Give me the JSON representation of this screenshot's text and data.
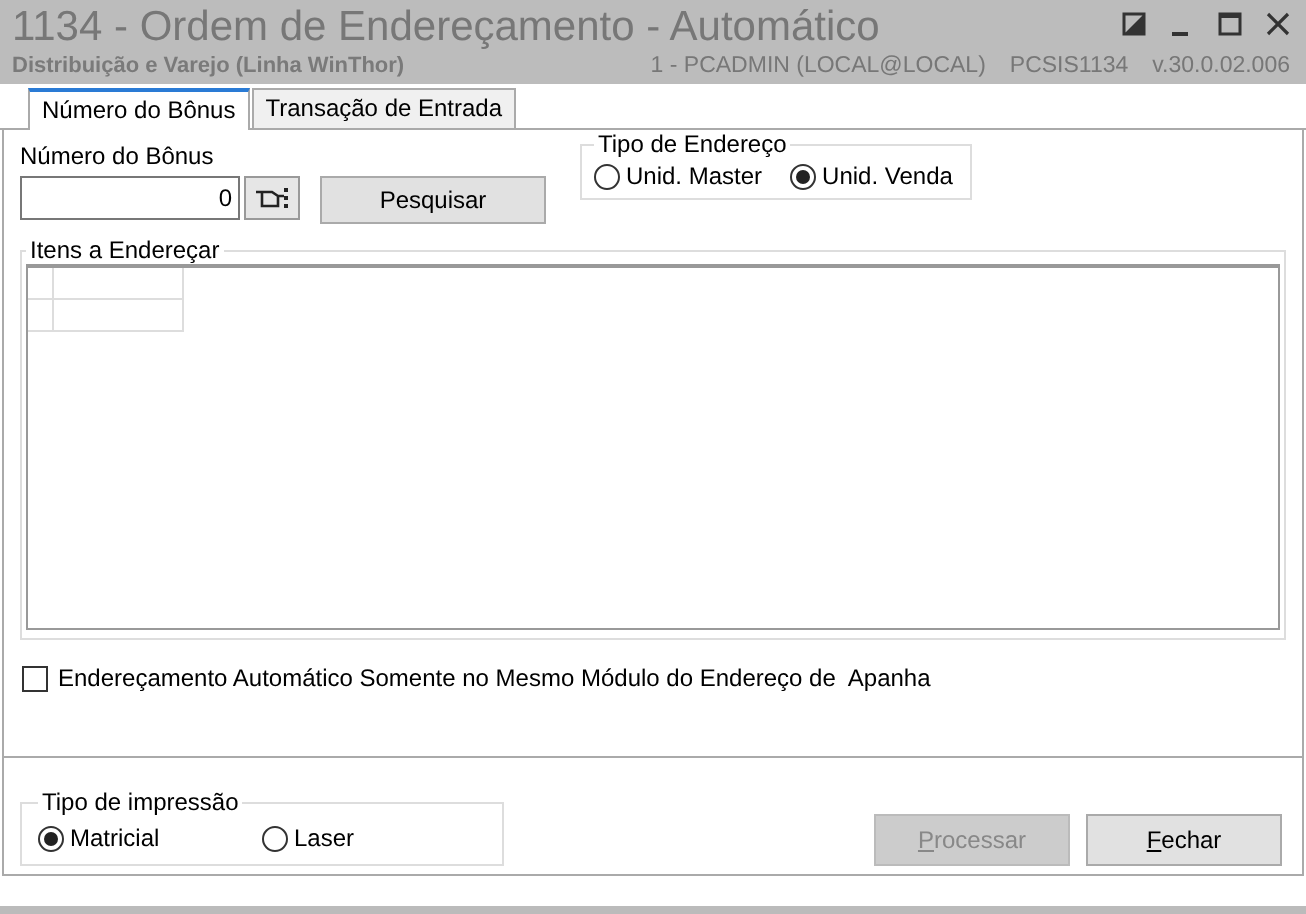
{
  "window": {
    "title": "1134 - Ordem de Endereçamento - Automático",
    "subtitle": "Distribuição e Varejo (Linha WinThor)",
    "user": "1 - PCADMIN (LOCAL@LOCAL)",
    "program": "PCSIS1134",
    "version": "v.30.0.02.006"
  },
  "tabs": [
    {
      "label": "Número do Bônus",
      "selected": true
    },
    {
      "label": "Transação de Entrada",
      "selected": false
    }
  ],
  "bonus": {
    "label": "Número do Bônus",
    "value": "0",
    "search_button": "Pesquisar"
  },
  "address_type": {
    "title": "Tipo de Endereço",
    "options": [
      {
        "label": "Unid. Master",
        "selected": false
      },
      {
        "label": "Unid. Venda",
        "selected": true
      }
    ]
  },
  "items": {
    "title": "Itens a Endereçar"
  },
  "same_module": {
    "label": "Endereçamento Automático Somente no Mesmo Módulo do Endereço de  Apanha",
    "checked": false
  },
  "print_type": {
    "title": "Tipo de impressão",
    "options": [
      {
        "label": "Matricial",
        "selected": true
      },
      {
        "label": "Laser",
        "selected": false
      }
    ]
  },
  "buttons": [
    {
      "label": "Processar",
      "disabled": true
    },
    {
      "label": "Fechar",
      "disabled": false
    }
  ]
}
